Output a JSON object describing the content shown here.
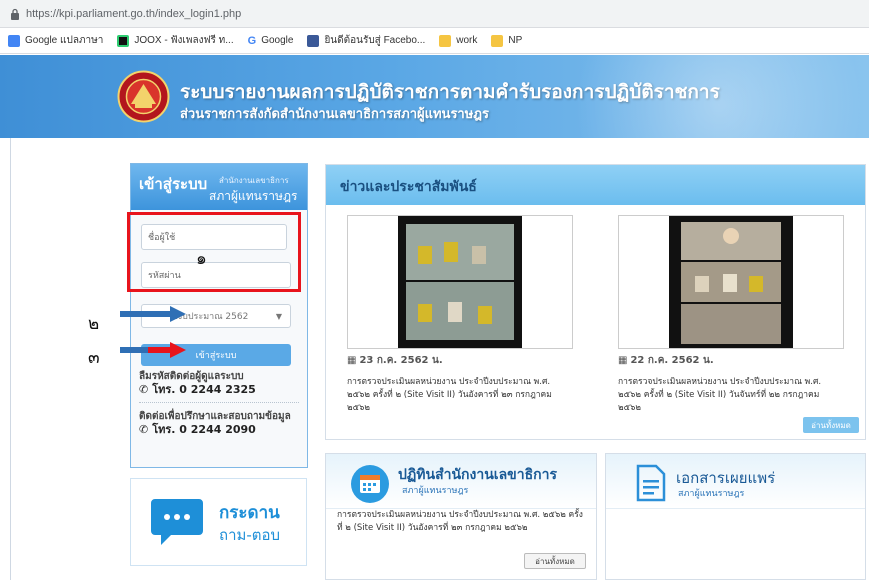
{
  "browser": {
    "url": "https://kpi.parliament.go.th/index_login1.php",
    "bookmarks": [
      "Google แปลภาษา",
      "JOOX - ฟังเพลงฟรี ท...",
      "Google",
      "ยินดีต้อนรับสู่ Facebo...",
      "work",
      "NP"
    ]
  },
  "header": {
    "title": "ระบบรายงานผลการปฏิบัติราชการตามคำรับรองการปฏิบัติราชการ",
    "subtitle": "ส่วนราชการสังกัดสำนักงานเลขาธิการสภาผู้แทนราษฎร"
  },
  "login": {
    "heading": "เข้าสู่ระบบ",
    "org_small": "สำนักงานเลขาธิการ",
    "org_large": "สภาผู้แทนราษฎร",
    "username_placeholder": "ชื่อผู้ใช้",
    "password_placeholder": "รหัสผ่าน",
    "fiscal_year": "ปีงบประมาณ 2562",
    "submit_label": "เข้าสู่ระบบ",
    "forgot_label": "ลืมรหัสติดต่อผู้ดูแลระบบ",
    "forgot_phone": "โทร. 0 2244 2325",
    "consult_label": "ติดต่อเพื่อปรึกษาและสอบถามข้อมูล",
    "consult_phone": "โทร. 0 2244 2090"
  },
  "annotations": {
    "one": "๑",
    "two": "๒",
    "three": "๓"
  },
  "qa_board": {
    "line1": "กระดาน",
    "line2": "ถาม-ตอบ"
  },
  "news": {
    "title": "ข่าวและประชาสัมพันธ์",
    "items": [
      {
        "date": "23 ก.ค. 2562 น.",
        "text": "การตรวจประเมินผลหน่วยงาน ประจำปีงบประมาณ พ.ศ. ๒๕๖๒ ครั้งที่ ๒ (Site Visit II) วันอังคารที่ ๒๓ กรกฎาคม ๒๕๖๒"
      },
      {
        "date": "22 ก.ค. 2562 น.",
        "text": "การตรวจประเมินผลหน่วยงาน ประจำปีงบประมาณ พ.ศ. ๒๕๖๒ ครั้งที่ ๒ (Site Visit II) วันจันทร์ที่ ๒๒ กรกฎาคม ๒๕๖๒"
      }
    ],
    "more_label": "อ่านทั้งหมด"
  },
  "activity": {
    "title": "ปฏิทินสำนักงานเลขาธิการ",
    "subtitle": "สภาผู้แทนราษฎร",
    "text": "การตรวจประเมินผลหน่วยงาน ประจำปีงบประมาณ พ.ศ. ๒๕๖๒ ครั้งที่ ๒ (Site Visit II) วันอังคารที่ ๒๓ กรกฎาคม ๒๕๖๒",
    "more_label": "อ่านทั้งหมด"
  },
  "publications": {
    "title": "เอกสารเผยแพร่",
    "subtitle": "สภาผู้แทนราษฎร"
  },
  "colors": {
    "header_blue": "#3f8fd6",
    "annotation_red": "#e8141c",
    "arrow_blue": "#2f6fb5",
    "button_blue": "#5aa9e6"
  }
}
